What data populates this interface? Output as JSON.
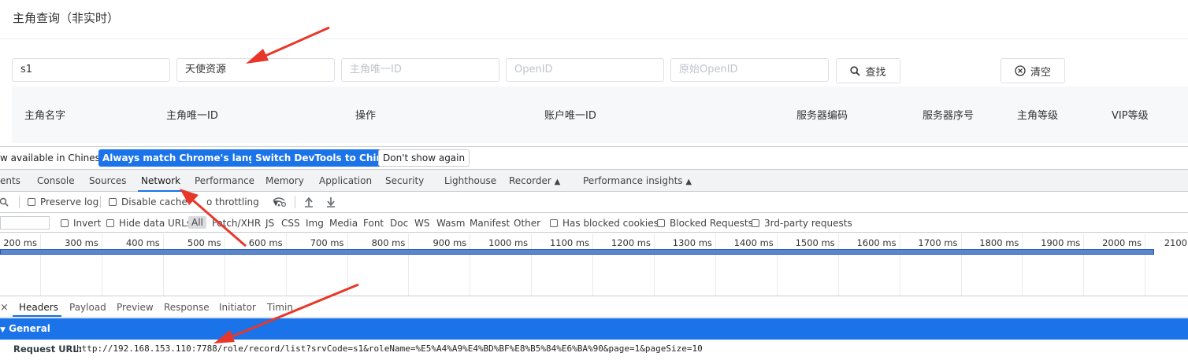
{
  "page": {
    "title": "主角查询（非实时）",
    "filters": [
      {
        "value": "s1",
        "placeholder": ""
      },
      {
        "value": "天使资源",
        "placeholder": ""
      },
      {
        "value": "",
        "placeholder": "主角唯一ID"
      },
      {
        "value": "",
        "placeholder": "OpenID"
      },
      {
        "value": "",
        "placeholder": "原始OpenID"
      }
    ],
    "search_label": "查找",
    "clear_label": "清空",
    "columns": [
      "主角名字",
      "主角唯一ID",
      "操作",
      "账户唯一ID",
      "服务器编码",
      "服务器序号",
      "主角等级",
      "VIP等级"
    ]
  },
  "devtools": {
    "banner": {
      "text": "w available in Chinese!",
      "btn_match": "Always match Chrome's language",
      "btn_switch": "Switch DevTools to Chinese",
      "btn_dismiss": "Don't show again"
    },
    "tabs": [
      "ents",
      "Console",
      "Sources",
      "Network",
      "Performance",
      "Memory",
      "Application",
      "Security",
      "Lighthouse",
      "Recorder",
      "Performance insights"
    ],
    "active_tab": "Network",
    "toolbar": {
      "preserve_log": "Preserve log",
      "disable_cache": "Disable cache",
      "throttling": "o throttling"
    },
    "filterbar": {
      "invert": "Invert",
      "hide_data_urls": "Hide data URLs",
      "types": [
        "All",
        "Fetch/XHR",
        "JS",
        "CSS",
        "Img",
        "Media",
        "Font",
        "Doc",
        "WS",
        "Wasm",
        "Manifest",
        "Other"
      ],
      "has_blocked_cookies": "Has blocked cookies",
      "blocked_requests": "Blocked Requests",
      "third_party": "3rd-party requests"
    },
    "timeline_ticks": [
      "200 ms",
      "300 ms",
      "400 ms",
      "500 ms",
      "600 ms",
      "700 ms",
      "800 ms",
      "900 ms",
      "1000 ms",
      "1100 ms",
      "1200 ms",
      "1300 ms",
      "1400 ms",
      "1500 ms",
      "1600 ms",
      "1700 ms",
      "1800 ms",
      "1900 ms",
      "2000 ms",
      "2100"
    ],
    "detail_tabs": [
      "Headers",
      "Payload",
      "Preview",
      "Response",
      "Initiator",
      "Timin"
    ],
    "general_label": "General",
    "request_url_label": "Request URL:",
    "request_url": "http://192.168.153.110:7788/role/record/list?srvCode=s1&roleName=%E5%A4%A9%E4%BD%BF%E8%B5%84%E6%BA%90&page=1&pageSize=10"
  },
  "colors": {
    "accent": "#1a73e8",
    "annotation_arrow": "#e8372a"
  }
}
